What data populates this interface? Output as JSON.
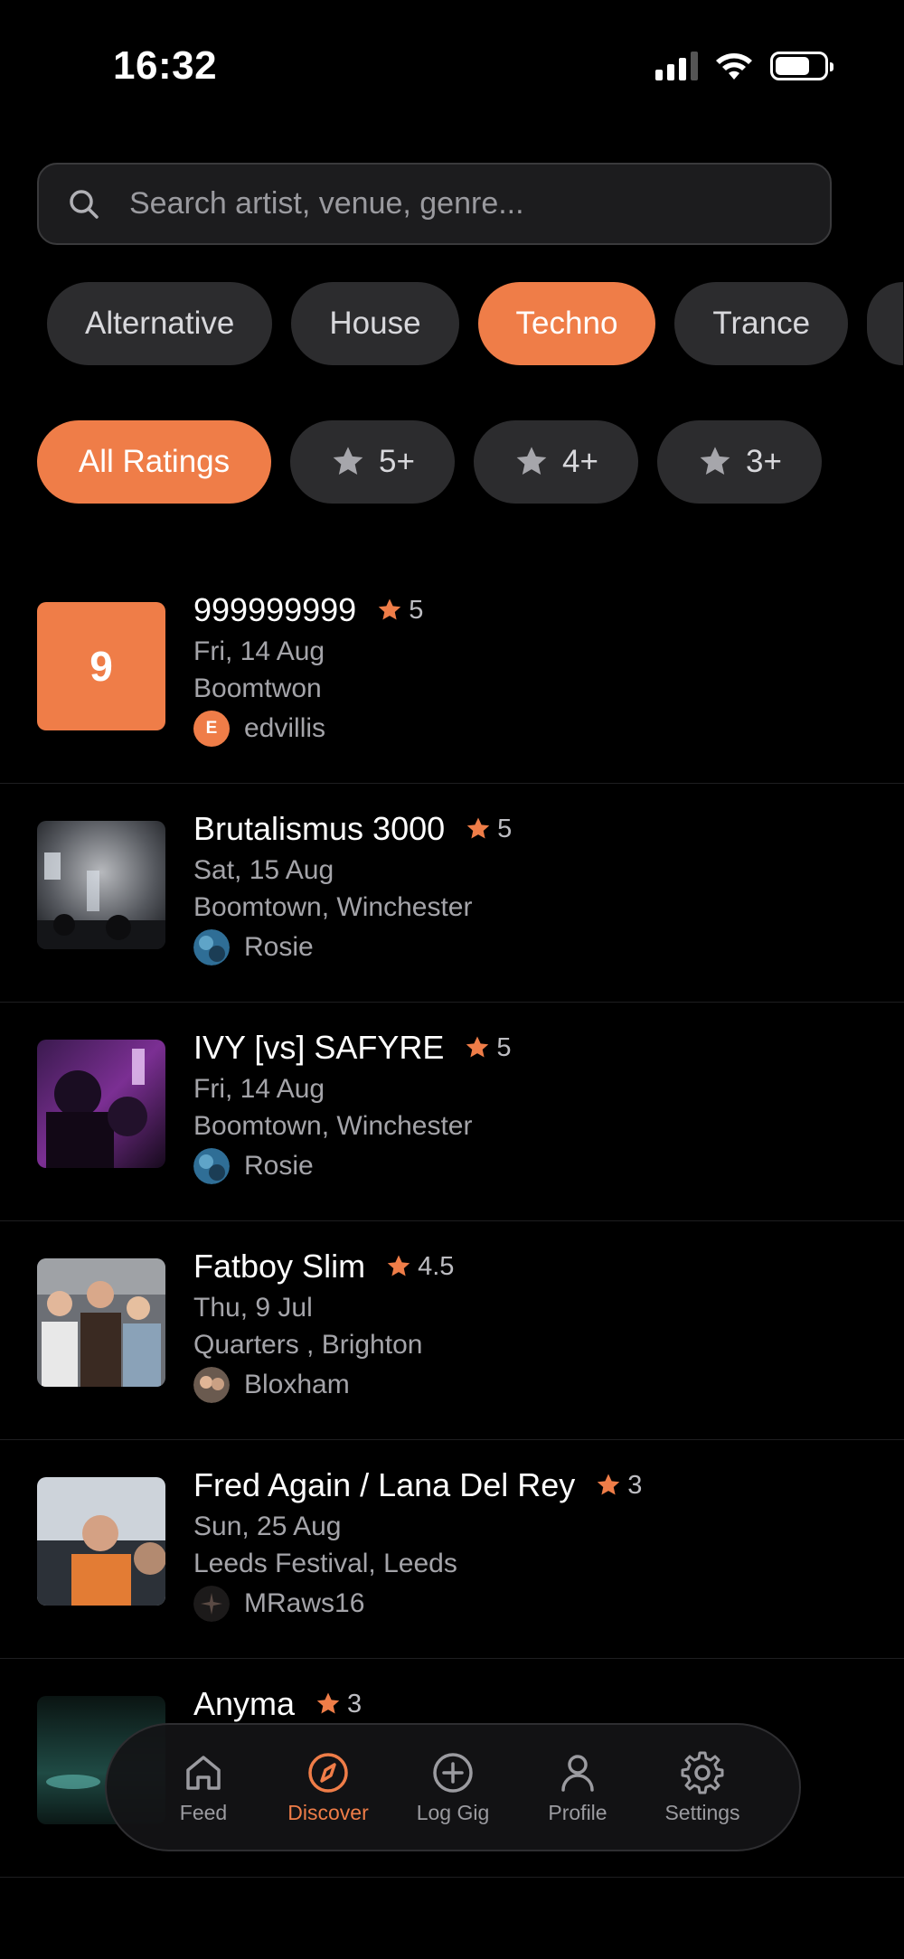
{
  "status_bar": {
    "time": "16:32"
  },
  "search": {
    "placeholder": "Search artist, venue, genre..."
  },
  "genre_filters": [
    {
      "label": "Alternative",
      "active": false
    },
    {
      "label": "House",
      "active": false
    },
    {
      "label": "Techno",
      "active": true
    },
    {
      "label": "Trance",
      "active": false
    }
  ],
  "rating_filters": [
    {
      "label": "All Ratings",
      "active": true,
      "icon": ""
    },
    {
      "label": "5+",
      "active": false,
      "icon": "star-icon"
    },
    {
      "label": "4+",
      "active": false,
      "icon": "star-icon"
    },
    {
      "label": "3+",
      "active": false,
      "icon": "star-icon"
    }
  ],
  "gigs": [
    {
      "title": "999999999",
      "rating": "5",
      "date": "Fri, 14 Aug",
      "venue": "Boomtwon",
      "user": "edvillis",
      "thumb_letter": "9",
      "avatar_letter": "E"
    },
    {
      "title": "Brutalismus 3000",
      "rating": "5",
      "date": "Sat, 15 Aug",
      "venue": "Boomtown, Winchester",
      "user": "Rosie"
    },
    {
      "title": "IVY [vs] SAFYRE",
      "rating": "5",
      "date": "Fri, 14 Aug",
      "venue": "Boomtown, Winchester",
      "user": "Rosie"
    },
    {
      "title": "Fatboy Slim",
      "rating": "4.5",
      "date": "Thu, 9 Jul",
      "venue": "Quarters , Brighton",
      "user": "Bloxham"
    },
    {
      "title": "Fred Again / Lana Del Rey",
      "rating": "3",
      "date": "Sun, 25 Aug",
      "venue": "Leeds Festival, Leeds",
      "user": "MRaws16"
    },
    {
      "title": "Anyma",
      "rating": "3"
    }
  ],
  "tab_bar": {
    "feed": "Feed",
    "discover": "Discover",
    "log_gig": "Log Gig",
    "profile": "Profile",
    "settings": "Settings",
    "active": "discover"
  },
  "colors": {
    "accent": "#ef7d48",
    "background": "#000000",
    "chip": "#2c2c2e"
  }
}
